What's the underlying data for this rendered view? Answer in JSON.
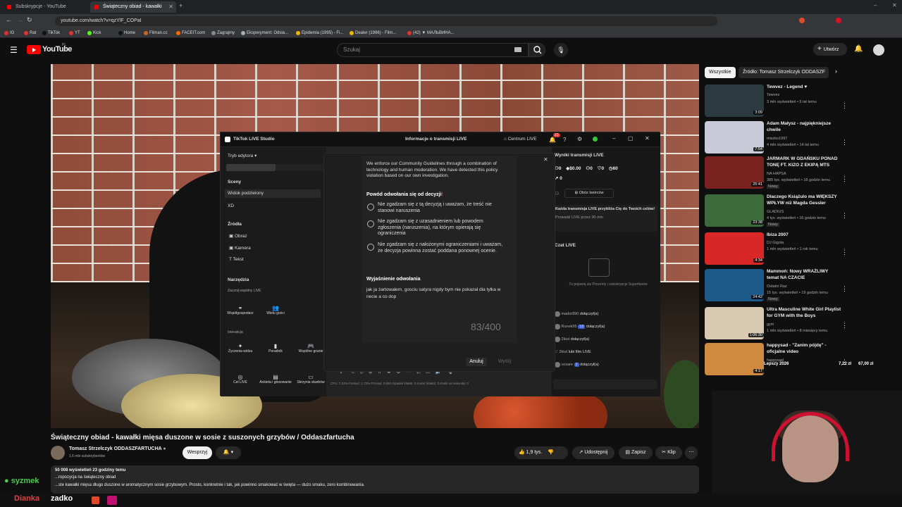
{
  "browser": {
    "tabs": [
      {
        "label": "Subskrypcje - YouTube"
      },
      {
        "label": "Świąteczny obiad - kawałki mięs..."
      }
    ],
    "url": "youtube.com/watch?v=qzYlF_COPaI",
    "bookmarks": [
      "IG",
      "Rat",
      "TikTok",
      "YT",
      "Kick",
      "Home",
      "Filman.cc",
      "FACEIT.com",
      "Zagrajmy",
      "Eksperyment: Odsia...",
      "Epidemia (1995) - Fi...",
      "Dealer (1996) - Film...",
      "(42) ▼ МАЛЬВИНА..."
    ]
  },
  "youtube": {
    "logo_label": "YouTube",
    "region": "PL",
    "search_placeholder": "Szukaj",
    "create_label": "Utwórz"
  },
  "tiktok": {
    "title": "TikTok LIVE Studio",
    "center_title": "Informacje o transmisji LIVE",
    "live_center": "Centrum LIVE",
    "badge": "23",
    "editor_mode": "Tryb edytora",
    "scenes_label": "Sceny",
    "scenes": [
      "Widok podzielony",
      "XD"
    ],
    "sources_label": "Źródła",
    "sources": [
      "Obraz",
      "Kamera",
      "Tekst"
    ],
    "tools_label": "Narzędzia",
    "tools_sub": "Zacznij wspólny LIVE",
    "tools": [
      "Współgospodarz",
      "Wielu gości"
    ],
    "interaction_label": "Interakcja",
    "interaction": [
      "Życzenia widza",
      "Poradnik",
      "Wspólne granie",
      "Cel LIVE",
      "Ankieta i głosowanie",
      "Skrzynia skarbów"
    ],
    "results_title": "Wyniki transmisji LIVE",
    "stats": [
      "0",
      "$0.00",
      "0",
      "0",
      "60"
    ],
    "stat_extra": "0",
    "creators_btn": "Obóz twórców",
    "promo_text": "Każda transmisja LIVE przybliża Cię do Twoich celów!",
    "promo_sub": "Prowadź LIVE przez 30 min",
    "chat_title": "Czat LIVE",
    "chat_empty": "Tu pojawią się Prezenty i subskrypcje Superfanów",
    "chat": [
      {
        "user": "mador890",
        "text": "dołączył(a)"
      },
      {
        "user": "Runek95",
        "text": "dołączył(a)",
        "lvl": "18"
      },
      {
        "user": "2kiut",
        "text": "dołączył(a)"
      },
      {
        "user": "2kiut",
        "text": "lubi film LIVE"
      },
      {
        "user": "cesare",
        "text": "dołączył(a)",
        "lvl": "2"
      }
    ],
    "statusbar": "CPU: 7.34%   Pamięć: 1.73%   Przesył: 0 kb/s   Spadek klatek: 0   Koder (klatki): 0   Klatki na sekundę: 0"
  },
  "dialog": {
    "intro": "We enforce our Community Guidelines through a combination of technology and human moderation. We have detected this policy violation based on our own investigation.",
    "reason_title": "Powód odwołania się od decyzji",
    "options": [
      "Nie zgadzam się z tą decyzją i uważam, że treść nie stanowi naruszenia",
      "Nie zgadzam się z uzasadnieniem lub powodem zgłoszenia (naruszenia), na którym opierają się ograniczenia",
      "Nie zgadzam się z nałożonymi ograniczeniami i uważam, że decyzja powinna zostać poddana ponownej ocenie."
    ],
    "explain_title": "Wyjaśnienie odwołania",
    "explain_text": "jak ja żartowałem,  gosciu satyra nigdy bym nie pokazał dla tylka w necie a co dop",
    "counter": "83/400",
    "cancel": "Anuluj",
    "send": "Wyślij"
  },
  "sidebar": {
    "chips": [
      "Wszystkie",
      "Źródło: Tomasz Strzelczyk ODDASZF"
    ],
    "items": [
      {
        "title": "Tewvez - Legend ♥",
        "channel": "Tewvez",
        "meta": "3 mln wyświetleń • 5 lat temu",
        "dur": "3:09",
        "color": "#2b3a40"
      },
      {
        "title": "Adam Małysz - najpiękniejsze chwile",
        "channel": "miszko1997",
        "meta": "4 mln wyświetleń • 14 lat temu",
        "dur": "7:54",
        "color": "#c9ccd8"
      },
      {
        "title": "JARMARK W GDAŃSKU PONAD TONĘ FT. KIZO Z EKIPĄ MTS",
        "channel": "NA HAPSA",
        "meta": "385 tys. wyświetleń • 18 godzin temu",
        "dur": "25:41",
        "color": "#7a2220"
      },
      {
        "title": "Dlaczego Książulo ma WIĘKSZY WPŁYW niż Magda Gessler",
        "channel": "GLADIUS",
        "meta": "4 tys. wyświetleń • 16 godzin temu",
        "dur": "23:38",
        "color": "#3d6a3a"
      },
      {
        "title": "Ibiza 2007",
        "channel": "DJ Gigola",
        "meta": "1 mln wyświetleń • 1 rok temu",
        "dur": "4:34",
        "color": "#d92727"
      },
      {
        "title": "Mammoń: Nowy WRAŻLIWY temat NA CZACIE",
        "channel": "Ostatni Raz",
        "meta": "15 tys. wyświetleń • 19 godzin temu",
        "dur": "24:42",
        "color": "#1d5a8a"
      },
      {
        "title": "Ultra Masculine White Girl Playlist for GYM with the Boys",
        "channel": "gym",
        "meta": "1 mln wyświetleń • 8 miesięcy temu",
        "dur": "1:06:30",
        "color": "#d8c9b0"
      },
      {
        "title": "happysad - \"Zanim pójdę\" - oficjalne video",
        "channel": "happysad",
        "meta": "",
        "dur": "4:17",
        "color": "#cf8a40"
      }
    ],
    "new_label": "Nowy"
  },
  "video": {
    "title": "Świąteczny obiad - kawałki mięsa duszone w sosie z suszonych grzybów / Oddaszfartucha",
    "channel": "Tomasz Strzelczyk ODDASZFARTUCHA",
    "subs": "1,6 mln subskrybentów",
    "support": "Wesprzyj",
    "likes": "1,9 tys.",
    "share": "Udostępnij",
    "save": "Zapisz",
    "clip": "Klip",
    "views": "50 008 wyświetleń  23 godziny temu",
    "desc1": "...ropozycja na świąteczny obiad",
    "desc2": "...ste kawałki mięsa długo duszone w aromatycznym sosie grzybowym. Prosto, konkretnie i tak, jak powinno smakować w święta — dużo smaku, zero kombinowania."
  },
  "overlay": {
    "donate_line": "Lepszy 2026",
    "amount1": "7,22 zł",
    "amount2": "67,00 zł",
    "name1": "syzmek",
    "name2": "zadko",
    "name3": "Dianka"
  }
}
